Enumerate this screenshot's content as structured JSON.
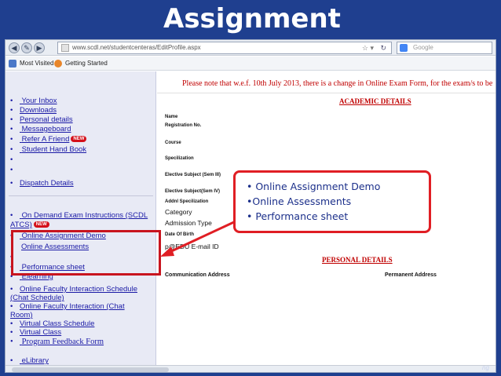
{
  "slide": {
    "title": "Assignment"
  },
  "browser": {
    "url": "www.scdl.net/studentcenteras/EditProfile.aspx",
    "search_placeholder": "Google",
    "bookmarks": [
      "Most Visited",
      "Getting Started"
    ]
  },
  "sidebar": {
    "items": [
      {
        "label": "Your Inbox"
      },
      {
        "label": "Downloads"
      },
      {
        "label": "Personal details"
      },
      {
        "label": "Messageboard"
      },
      {
        "label": "Refer A Friend"
      },
      {
        "label": "Student Hand Book"
      },
      {
        "label": "Dispatch Details"
      },
      {
        "label": "On Demand Exam Instructions (SCDL"
      },
      {
        "label": "ATCS)"
      },
      {
        "label": "Online Assignment Demo"
      },
      {
        "label": "Online Assessments"
      },
      {
        "label": "Performance sheet"
      },
      {
        "label": "Elearning"
      },
      {
        "label": "Online Faculty Interaction Schedule"
      },
      {
        "label": "(Chat Schedule)"
      },
      {
        "label": "Online Faculty Interaction (Chat"
      },
      {
        "label": "Room)"
      },
      {
        "label": "Virtual Class Schedule"
      },
      {
        "label": "Virtual Class"
      },
      {
        "label": "Program Feedback Form"
      },
      {
        "label": "eLibrary"
      }
    ],
    "badge": "NEW"
  },
  "main": {
    "notice": "Please note that w.e.f. 10th July 2013, there is a change in Online Exam Form, for the exam/s to be",
    "academic_header": "ACADEMIC DETAILS",
    "personal_header": "PERSONAL DETAILS",
    "fields": {
      "name": "Name",
      "reg": "Registration No.",
      "course": "Course",
      "spec": "Specilization",
      "elective3": "Elective Subject (Sem III)",
      "elective4": "Elective Subject(Sem IV)",
      "addl_spec": "Addnl Specilization",
      "category": "Category",
      "admission": "Admission Type",
      "dob": "Date Of Birth",
      "email": "p@EDU E-mail ID"
    },
    "comm_address": "Communication Address",
    "perm_address": "Permanent Address"
  },
  "callout": {
    "lines": [
      "• Online Assignment Demo",
      "•Online Assessments",
      "• Performance sheet"
    ]
  },
  "corner_text": "ng",
  "colors": {
    "accent_red": "#c8141e",
    "slide_blue": "#1f3f8f",
    "link_blue": "#1a1aa6"
  }
}
